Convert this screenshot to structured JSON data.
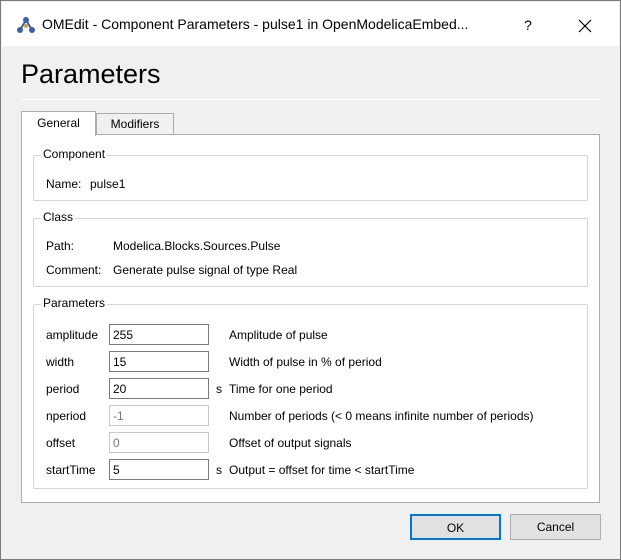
{
  "window": {
    "title": "OMEdit - Component Parameters - pulse1 in OpenModelicaEmbed...",
    "help_glyph": "?",
    "close_glyph": "✕"
  },
  "heading": "Parameters",
  "tabs": [
    {
      "label": "General",
      "selected": true
    },
    {
      "label": "Modifiers",
      "selected": false
    }
  ],
  "component": {
    "group_title": "Component",
    "name_label": "Name:",
    "name_value": "pulse1"
  },
  "class": {
    "group_title": "Class",
    "path_label": "Path:",
    "path_value": "Modelica.Blocks.Sources.Pulse",
    "comment_label": "Comment:",
    "comment_value": "Generate pulse signal of type Real"
  },
  "parameters": {
    "group_title": "Parameters",
    "rows": [
      {
        "name": "amplitude",
        "value": "255",
        "placeholder": "",
        "unit": "",
        "description": "Amplitude of pulse",
        "enabled": true
      },
      {
        "name": "width",
        "value": "15",
        "placeholder": "",
        "unit": "",
        "description": "Width of pulse in % of period",
        "enabled": true
      },
      {
        "name": "period",
        "value": "20",
        "placeholder": "",
        "unit": "s",
        "description": "Time for one period",
        "enabled": true
      },
      {
        "name": "nperiod",
        "value": "",
        "placeholder": "-1",
        "unit": "",
        "description": "Number of periods (< 0 means infinite number of periods)",
        "enabled": false
      },
      {
        "name": "offset",
        "value": "",
        "placeholder": "0",
        "unit": "",
        "description": "Offset of output signals",
        "enabled": false
      },
      {
        "name": "startTime",
        "value": "5",
        "placeholder": "",
        "unit": "s",
        "description": "Output = offset for time < startTime",
        "enabled": true
      }
    ]
  },
  "buttons": {
    "ok": "OK",
    "cancel": "Cancel"
  },
  "colors": {
    "accent": "#0078d7",
    "window_bg": "#f0f0f0",
    "panel_bg": "#ffffff"
  }
}
